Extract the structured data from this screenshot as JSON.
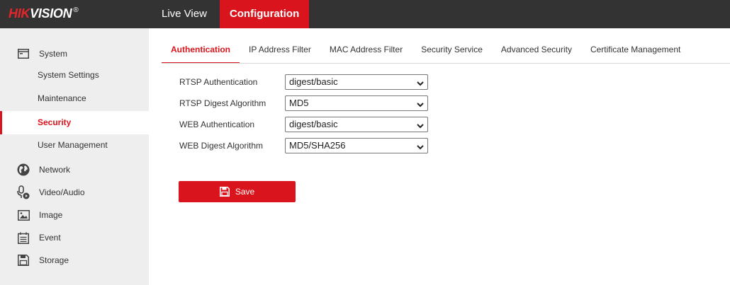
{
  "header": {
    "logo_red": "HIK",
    "logo_white": "VISION",
    "logo_reg": "®",
    "tabs": [
      {
        "label": "Live View"
      },
      {
        "label": "Configuration"
      }
    ]
  },
  "sidebar": {
    "system": {
      "label": "System",
      "icon": "monitor-icon"
    },
    "system_items": [
      {
        "label": "System Settings"
      },
      {
        "label": "Maintenance"
      },
      {
        "label": "Security"
      },
      {
        "label": "User Management"
      }
    ],
    "network": {
      "label": "Network",
      "icon": "globe-icon"
    },
    "video_audio": {
      "label": "Video/Audio",
      "icon": "microphone-icon"
    },
    "image": {
      "label": "Image",
      "icon": "image-icon"
    },
    "event": {
      "label": "Event",
      "icon": "calendar-icon"
    },
    "storage": {
      "label": "Storage",
      "icon": "floppy-disk-icon"
    }
  },
  "main": {
    "tabs": [
      {
        "label": "Authentication"
      },
      {
        "label": "IP Address Filter"
      },
      {
        "label": "MAC Address Filter"
      },
      {
        "label": "Security Service"
      },
      {
        "label": "Advanced Security"
      },
      {
        "label": "Certificate Management"
      }
    ],
    "form": [
      {
        "label": "RTSP Authentication",
        "value": "digest/basic"
      },
      {
        "label": "RTSP Digest Algorithm",
        "value": "MD5"
      },
      {
        "label": "WEB Authentication",
        "value": "digest/basic"
      },
      {
        "label": "WEB Digest Algorithm",
        "value": "MD5/SHA256"
      }
    ],
    "save_label": "Save"
  },
  "colors": {
    "accent": "#d9141c",
    "topbar": "#333333",
    "sidebar": "#eeeeee"
  }
}
